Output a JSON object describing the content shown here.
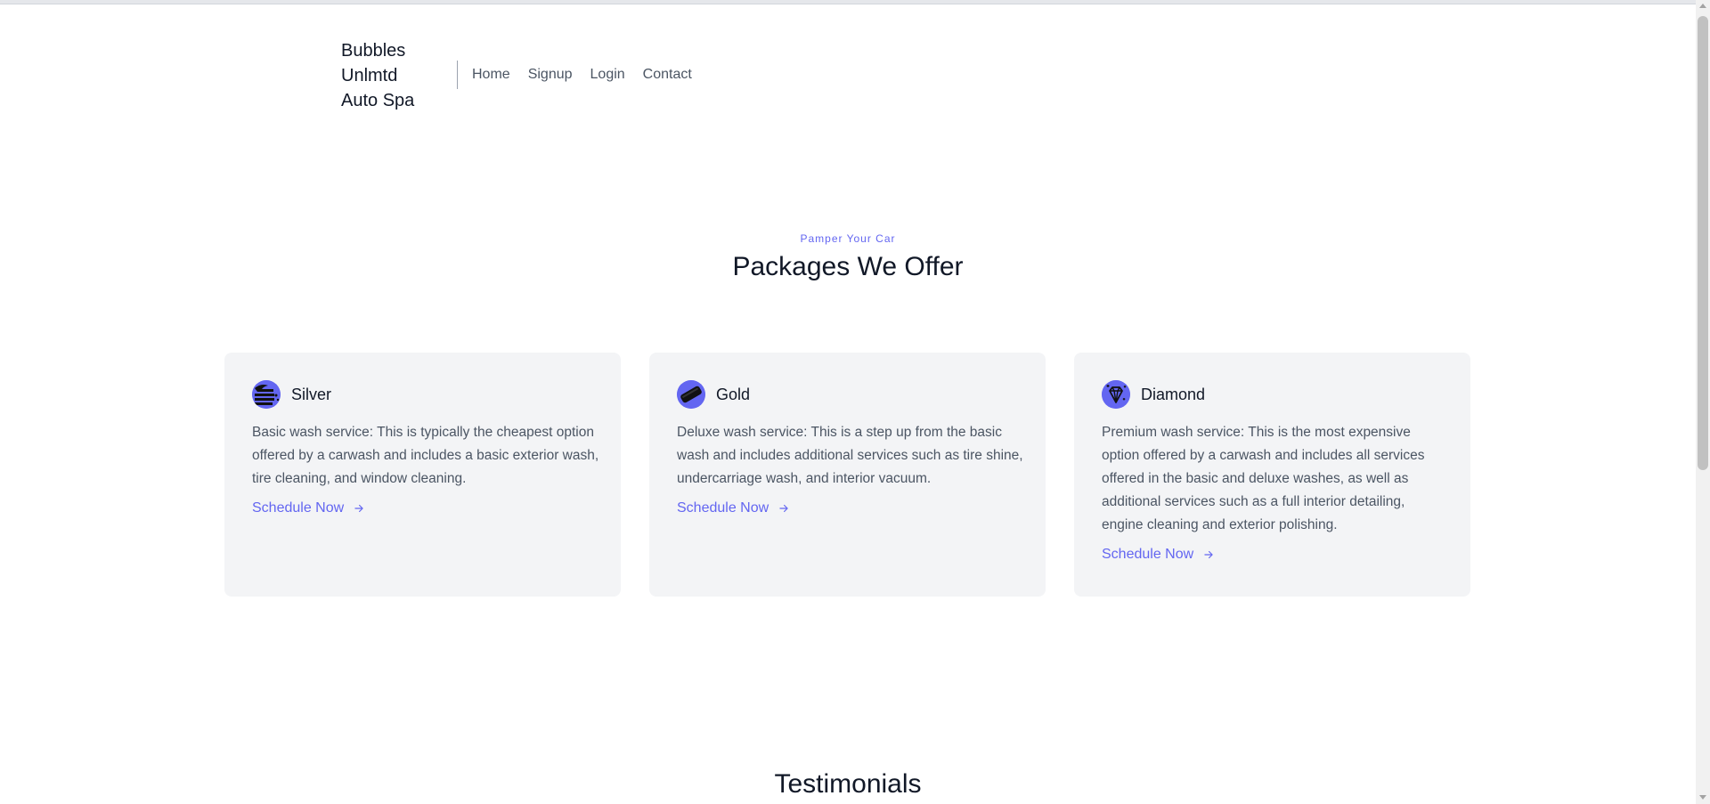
{
  "header": {
    "brand_lines": [
      "Bubbles",
      "Unlmtd",
      "Auto Spa"
    ],
    "nav": [
      "Home",
      "Signup",
      "Login",
      "Contact"
    ]
  },
  "section": {
    "eyebrow": "Pamper Your Car",
    "title": "Packages We Offer"
  },
  "packages": [
    {
      "title": "Silver",
      "icon": "car-wash-icon",
      "description": "Basic wash service: This is typically the cheapest option offered by a carwash and includes a basic exterior wash, tire cleaning, and window cleaning.",
      "link": "Schedule Now"
    },
    {
      "title": "Gold",
      "icon": "sponge-icon",
      "description": "Deluxe wash service: This is a step up from the basic wash and includes additional services such as tire shine, undercarriage wash, and interior vacuum.",
      "link": "Schedule Now"
    },
    {
      "title": "Diamond",
      "icon": "diamond-icon",
      "description": "Premium wash service: This is the most expensive option offered by a carwash and includes all services offered in the basic and deluxe washes, as well as additional services such as a full interior detailing, engine cleaning and exterior polishing.",
      "link": "Schedule Now"
    }
  ],
  "testimonials": {
    "title": "Testimonials"
  },
  "colors": {
    "accent": "#6366f1",
    "card_bg": "#f3f4f6",
    "text_muted": "#4b5563"
  }
}
